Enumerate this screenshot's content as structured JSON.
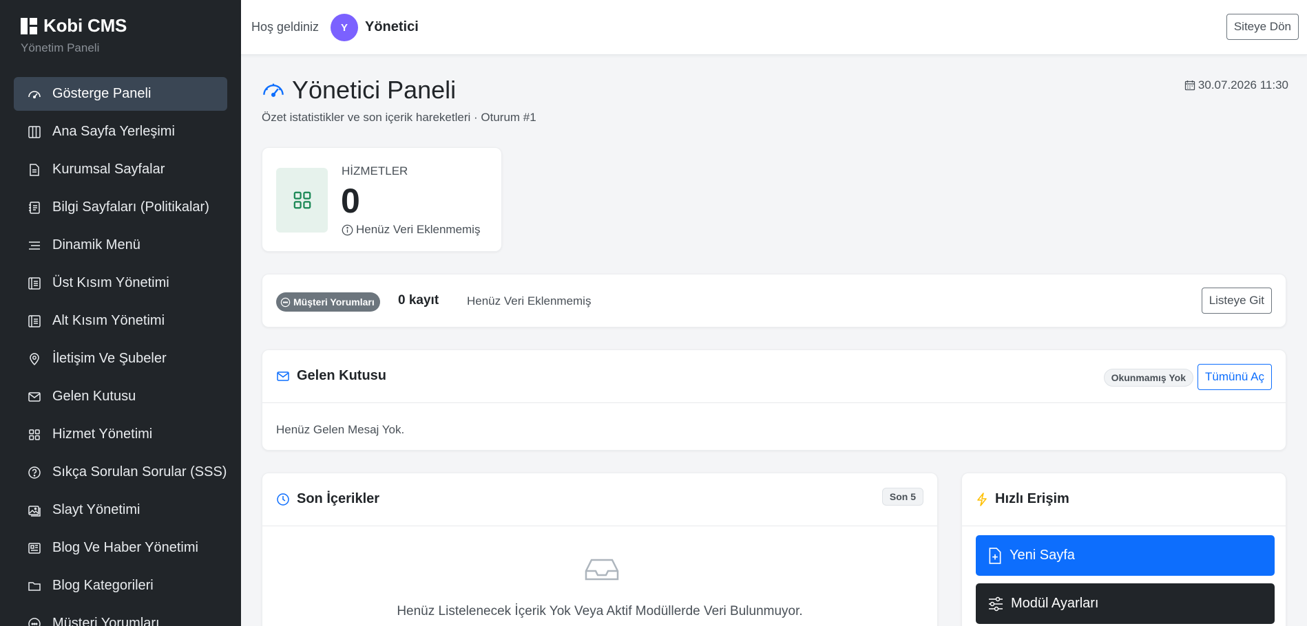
{
  "sidebar": {
    "brand": "Kobi CMS",
    "subtitle": "Yönetim Paneli",
    "items": [
      {
        "label": "Gösterge Paneli",
        "icon": "speedometer-icon",
        "active": true
      },
      {
        "label": "Ana Sayfa Yerleşimi",
        "icon": "layout-columns-icon"
      },
      {
        "label": "Kurumsal Sayfalar",
        "icon": "file-text-icon"
      },
      {
        "label": "Bilgi Sayfaları (Politikalar)",
        "icon": "journal-text-icon"
      },
      {
        "label": "Dinamik Menü",
        "icon": "text-lines-icon"
      },
      {
        "label": "Üst Kısım Yönetimi",
        "icon": "layout-list-icon"
      },
      {
        "label": "Alt Kısım Yönetimi",
        "icon": "layout-list-icon"
      },
      {
        "label": "İletişim Ve Şubeler",
        "icon": "location-pin-icon"
      },
      {
        "label": "Gelen Kutusu",
        "icon": "envelope-icon"
      },
      {
        "label": "Hizmet Yönetimi",
        "icon": "grid-icon"
      },
      {
        "label": "Sıkça Sorulan Sorular (SSS)",
        "icon": "question-circle-icon"
      },
      {
        "label": "Slayt Yönetimi",
        "icon": "images-icon"
      },
      {
        "label": "Blog Ve Haber Yönetimi",
        "icon": "newspaper-icon"
      },
      {
        "label": "Blog Kategorileri",
        "icon": "folder-icon"
      },
      {
        "label": "Müşteri Yorumları",
        "icon": "chat-icon"
      }
    ]
  },
  "header": {
    "welcome": "Hoş geldiniz",
    "avatar_initial": "Y",
    "user_name": "Yönetici",
    "site_button": "Siteye Dön"
  },
  "page": {
    "title": "Yönetici Paneli",
    "subtitle": "Özet istatistikler ve son içerik hareketleri · Oturum #1",
    "date": "30.07.2026 11:30"
  },
  "stat": {
    "label": "HİZMETLER",
    "value": "0",
    "note": "Henüz Veri Eklenmemiş"
  },
  "reviews": {
    "badge": "Müşteri Yorumları",
    "count": "0 kayıt",
    "note": "Henüz Veri Eklenmemiş",
    "button": "Listeye Git"
  },
  "inbox": {
    "title": "Gelen Kutusu",
    "unread_badge": "Okunmamış Yok",
    "open_all": "Tümünü Aç",
    "empty": "Henüz Gelen Mesaj Yok."
  },
  "recent": {
    "title": "Son İçerikler",
    "badge": "Son 5",
    "empty": "Henüz Listelenecek İçerik Yok Veya Aktif Modüllerde Veri Bulunmuyor."
  },
  "quick": {
    "title": "Hızlı Erişim",
    "new_page": "Yeni Sayfa",
    "module_settings": "Modül Ayarları"
  },
  "colors": {
    "sidebar_bg": "#212529",
    "active_item": "#3a4654",
    "primary": "#0d6efd",
    "avatar": "#7b61ff",
    "success_tint": "#e6f2ec",
    "success": "#198754",
    "warning": "#ffc107"
  }
}
